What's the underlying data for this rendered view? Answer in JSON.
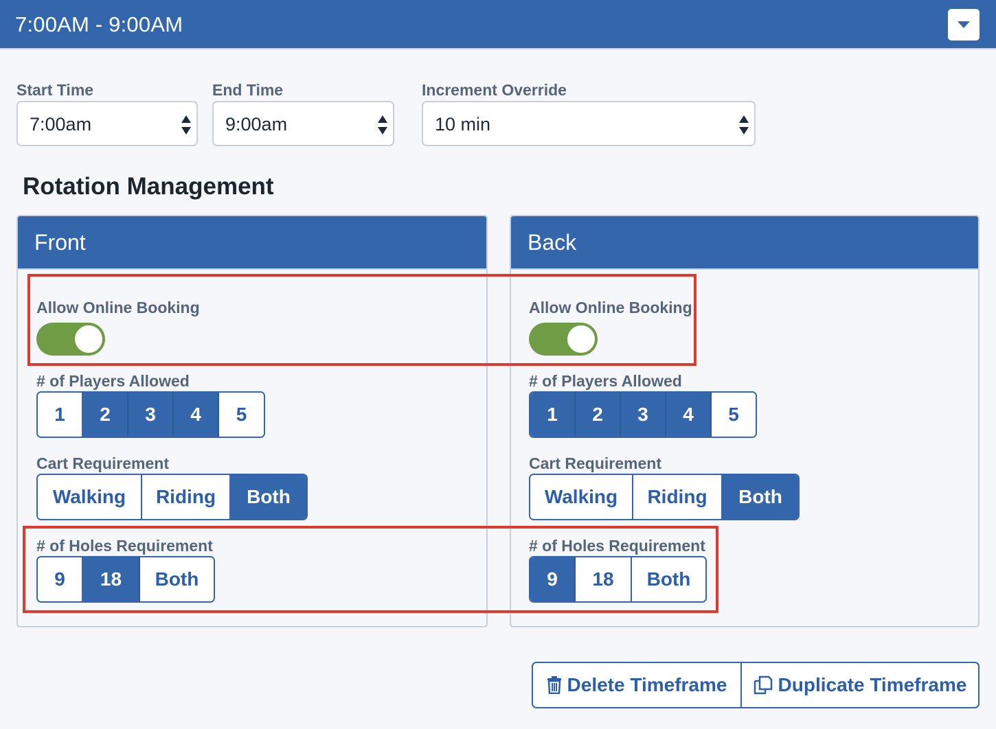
{
  "header": {
    "title": "7:00AM - 9:00AM",
    "dropdown_icon": "caret-down-icon"
  },
  "fields": {
    "start_time": {
      "label": "Start Time",
      "value": "7:00am"
    },
    "end_time": {
      "label": "End Time",
      "value": "9:00am"
    },
    "increment": {
      "label": "Increment Override",
      "value": "10 min"
    }
  },
  "section_title": "Rotation Management",
  "front": {
    "title": "Front",
    "online_label": "Allow Online Booking",
    "online_enabled": true,
    "players_label": "# of Players Allowed",
    "players": [
      "1",
      "2",
      "3",
      "4",
      "5"
    ],
    "players_selected": [
      "2",
      "3",
      "4"
    ],
    "cart_label": "Cart Requirement",
    "cart": [
      "Walking",
      "Riding",
      "Both"
    ],
    "cart_selected": "Both",
    "holes_label": "# of Holes Requirement",
    "holes": [
      "9",
      "18",
      "Both"
    ],
    "holes_selected": "18"
  },
  "back": {
    "title": "Back",
    "online_label": "Allow Online Booking",
    "online_enabled": true,
    "players_label": "# of Players Allowed",
    "players": [
      "1",
      "2",
      "3",
      "4",
      "5"
    ],
    "players_selected": [
      "1",
      "2",
      "3",
      "4"
    ],
    "cart_label": "Cart Requirement",
    "cart": [
      "Walking",
      "Riding",
      "Both"
    ],
    "cart_selected": "Both",
    "holes_label": "# of Holes Requirement",
    "holes": [
      "9",
      "18",
      "Both"
    ],
    "holes_selected": "9"
  },
  "actions": {
    "delete_label": "Delete Timeframe",
    "duplicate_label": "Duplicate Timeframe"
  },
  "colors": {
    "primary": "#3366aa",
    "toggle_on": "#6f9c44",
    "highlight": "#e03a2e",
    "background": "#f5f7fb"
  }
}
